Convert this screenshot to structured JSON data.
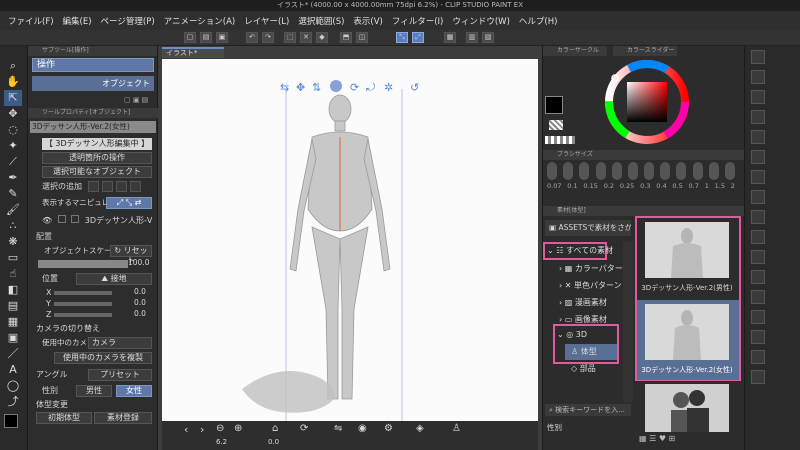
{
  "window": {
    "title": "イラスト* (4000.00 x 4000.00mm 75dpi 6.2%)  - CLIP STUDIO PAINT EX"
  },
  "menu": [
    "ファイル(F)",
    "編集(E)",
    "ページ管理(P)",
    "アニメーション(A)",
    "レイヤー(L)",
    "選択範囲(S)",
    "表示(V)",
    "フィルター(I)",
    "ウィンドウ(W)",
    "ヘルプ(H)"
  ],
  "subtool": {
    "header": "サブツール[操作]",
    "active": "操作",
    "item": "オブジェクト"
  },
  "toolprop": {
    "header": "ツールプロパティ[オブジェクト]",
    "object_name": "3Dデッサン人形-Ver.2(女性)",
    "editing_banner": "【 3Dデッサン人形編集中 】",
    "transparent_op": "透明箇所の操作",
    "selectable_object": "選択可能なオブジェクト",
    "add_selection": "選択の追加",
    "manipulator": "表示するマニピュレータ",
    "layer_item": "3Dデッサン人形-V",
    "placement": "配置",
    "object_scale": "オブジェクトスケール",
    "reset": "リセット",
    "scale_value": "100.0",
    "position": "位置",
    "ground": "接地",
    "x_label": "X",
    "x_value": "0.0",
    "y_label": "Y",
    "y_value": "0.0",
    "z_label": "Z",
    "z_value": "0.0",
    "camera_switch": "カメラの切り替え",
    "camera_in_use": "使用中のカメラ",
    "camera": "カメラ",
    "copy_camera": "使用中のカメラを複製",
    "angle": "アングル",
    "preset": "プリセット",
    "gender": "性別",
    "male": "男性",
    "female": "女性",
    "body_change": "体型変更",
    "initial_body": "初期体型",
    "register_material": "素材登録"
  },
  "canvas": {
    "tab": "イラスト*"
  },
  "bottombar": {
    "zoom": "6.2",
    "angle": "0.0"
  },
  "color": {
    "header1": "カラーサークル",
    "header2": "カラースライダー",
    "fg": "#000000",
    "accent": "#e05aa0"
  },
  "brushsize": {
    "header": "ブラシサイズ",
    "sizes": [
      "0.07",
      "0.1",
      "0.15",
      "0.2",
      "0.25",
      "0.3",
      "0.4",
      "0.5",
      "0.7",
      "1",
      "1.5",
      "2"
    ]
  },
  "material": {
    "header": "素材[体型]",
    "search_prompt": "ASSETSで素材をさがす",
    "tree": [
      "すべての素材",
      "カラーパターン",
      "単色パターン",
      "漫画素材",
      "画像素材",
      "3D",
      "体型",
      "部品"
    ],
    "items": [
      "3Dデッサン人形-Ver.2(男性)",
      "3Dデッサン人形-Ver.2(女性)"
    ],
    "search_placeholder": "検索キーワードを入...",
    "filter": "性別"
  }
}
